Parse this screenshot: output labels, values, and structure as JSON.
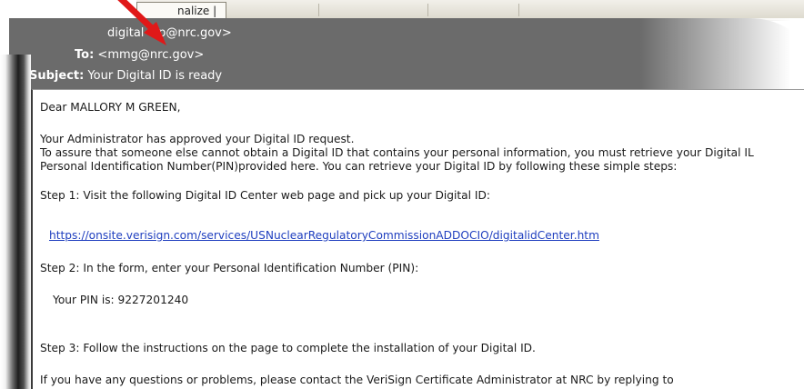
{
  "toolbar": {
    "tab_label": "nalize |"
  },
  "email": {
    "from_value": "digital   elp@nrc.gov>",
    "to_label": "To:",
    "to_value": "<mmg@nrc.gov>",
    "subject_label": "Subject:",
    "subject_value": "Your Digital ID is ready"
  },
  "body": {
    "greeting": "Dear MALLORY M GREEN,",
    "para1_line1": "Your Administrator has approved your Digital ID request.",
    "para1_line2": "To assure that someone else cannot obtain a Digital ID that contains your personal information, you must retrieve your Digital IL",
    "para1_line3": "Personal Identification Number(PIN)provided here. You can retrieve your Digital ID by following these simple steps:",
    "step1": "Step 1: Visit the following Digital ID Center web page and pick up your Digital ID:",
    "link": "https://onsite.verisign.com/services/USNuclearRegulatoryCommissionADDOCIO/digitalidCenter.htm",
    "step2": "Step 2: In the form, enter your Personal Identification Number (PIN):",
    "pin_line": "Your PIN is: 9227201240",
    "step3": "Step 3: Follow the instructions on the page to complete the installation of your Digital ID.",
    "closing": "If you have any questions or problems, please contact the VeriSign Certificate Administrator at NRC by replying to"
  },
  "colors": {
    "header_bg": "#6b6b6b",
    "link": "#1f3fbf",
    "arrow": "#e01818"
  },
  "icons": {
    "annotation": "red-arrow-icon"
  }
}
